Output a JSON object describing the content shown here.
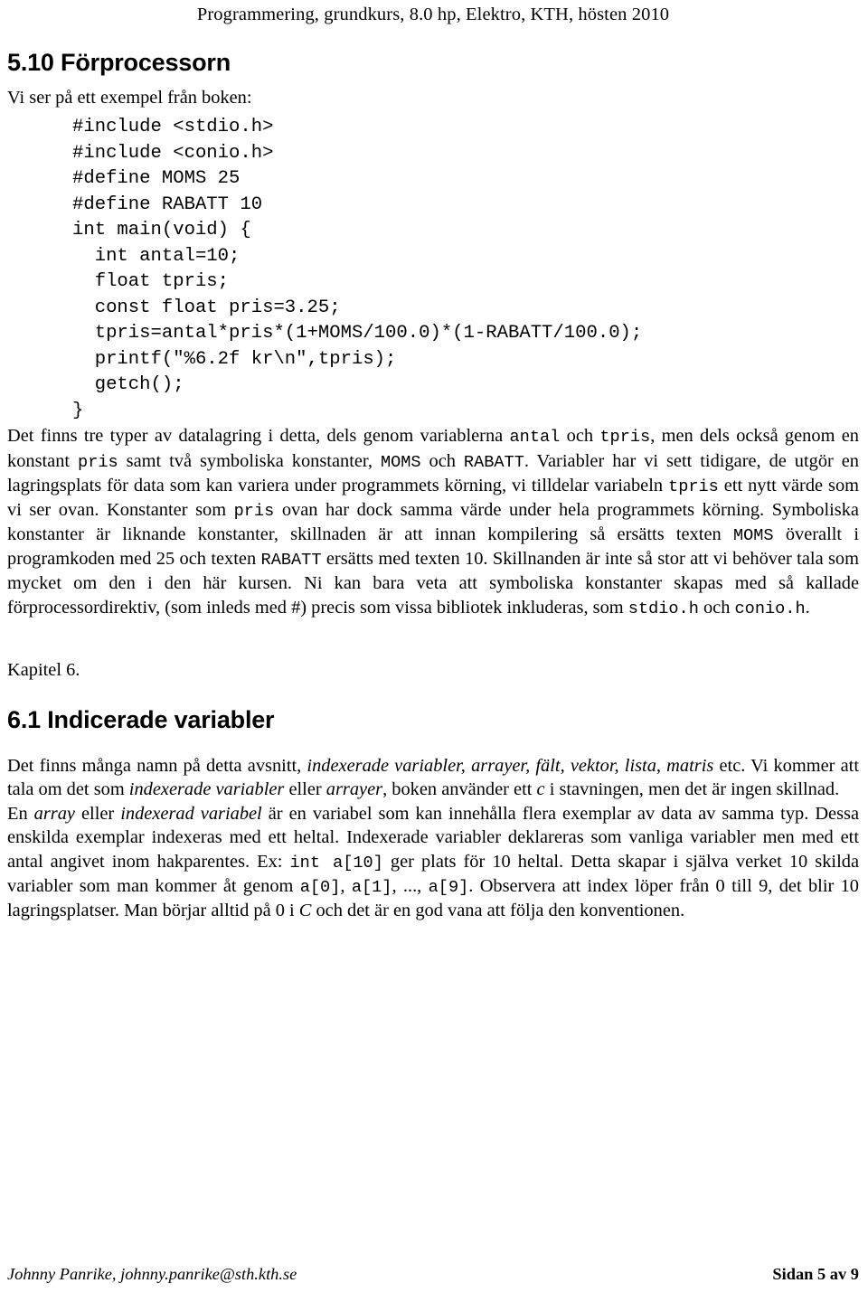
{
  "header": {
    "running_title": "Programmering, grundkurs, 8.0 hp, Elektro, KTH, hösten 2010"
  },
  "sections": [
    {
      "number_title": "5.10 Förprocessorn",
      "intro": "Vi ser på ett exempel från boken:"
    },
    {
      "number_title": "6.1 Indicerade variabler"
    }
  ],
  "code_block": {
    "language": "c",
    "lines": [
      "#include <stdio.h>",
      "#include <conio.h>",
      "#define MOMS 25",
      "#define RABATT 10",
      "int main(void) {",
      "  int antal=10;",
      "  float tpris;",
      "  const float pris=3.25;",
      "  tpris=antal*pris*(1+MOMS/100.0)*(1-RABATT/100.0);",
      "  printf(\"%6.2f kr\\n\",tpris);",
      "  getch();",
      "}"
    ],
    "text": "#include <stdio.h>\n#include <conio.h>\n#define MOMS 25\n#define RABATT 10\nint main(void) {\n  int antal=10;\n  float tpris;\n  const float pris=3.25;\n  tpris=antal*pris*(1+MOMS/100.0)*(1-RABATT/100.0);\n  printf(\"%6.2f kr\\n\",tpris);\n  getch();\n}"
  },
  "paragraph_1": {
    "t1": "Det finns tre typer av datalagring i detta, dels genom variablerna ",
    "c1": "antal",
    "t2": " och ",
    "c2": "tpris",
    "t3": ", men dels också genom en konstant ",
    "c3": "pris",
    "t4": " samt två symboliska konstanter, ",
    "c4": "MOMS",
    "t5": " och ",
    "c5": "RABATT",
    "t6": ". Variabler har vi sett tidigare, de utgör en lagringsplats för data som kan variera under programmets körning, vi tilldelar variabeln ",
    "c6": "tpris",
    "t7": " ett nytt värde som vi ser ovan. Konstanter som ",
    "c7": "pris",
    "t8": " ovan har dock samma värde under hela programmets körning. Symboliska konstanter är liknande konstanter, skillnaden är att innan kompilering så ersätts texten ",
    "c8": "MOMS",
    "t9": " överallt i programkoden med 25 och texten ",
    "c9": "RABATT",
    "t10": " ersätts med texten 10. Skillnanden är inte så stor att vi behöver tala som mycket om den i den här kursen. Ni kan bara veta att symboliska konstanter skapas med så kallade förprocessordirektiv, (som inleds med #) precis som vissa bibliotek inkluderas, som ",
    "c10": "stdio.h",
    "t11": " och ",
    "c11": "conio.h",
    "t12": "."
  },
  "kapitel_line": "Kapitel 6.",
  "paragraph_2": {
    "t1": "Det finns många namn på detta avsnitt, ",
    "i1": "indexerade variabler, arrayer, fält, vektor, lista, matris",
    "t2": " etc. Vi kommer att tala om det som ",
    "i2": "indexerade variabler",
    "t3": " eller ",
    "i3": "arrayer",
    "t4": ", boken använder ett ",
    "i4": "c",
    "t5": " i stavningen, men det är ingen skillnad."
  },
  "paragraph_3": {
    "t1": "En ",
    "i1": "array",
    "t2": " eller ",
    "i2": "indexerad variabel",
    "t3": " är en variabel som kan innehålla flera exemplar av data av samma typ. Dessa enskilda exemplar indexeras med ett heltal. Indexerade variabler deklareras som vanliga variabler men med ett antal angivet inom hakparentes. Ex: ",
    "c1": "int a[10]",
    "t4": " ger plats för 10 heltal. Detta skapar i själva verket 10 skilda variabler som man kommer åt genom ",
    "c2": "a[0]",
    "t5": ", ",
    "c3": "a[1]",
    "t6": ", ..., ",
    "c4": "a[9]",
    "t7": ". Observera att index löper från 0 till 9, det blir 10 lagringsplatser. Man börjar alltid på 0 i ",
    "i3": "C",
    "t8": " och det är en god vana att följa den konventionen."
  },
  "footer": {
    "author_contact": "Johnny Panrike, johnny.panrike@sth.kth.se",
    "page_label": "Sidan 5 av 9"
  }
}
